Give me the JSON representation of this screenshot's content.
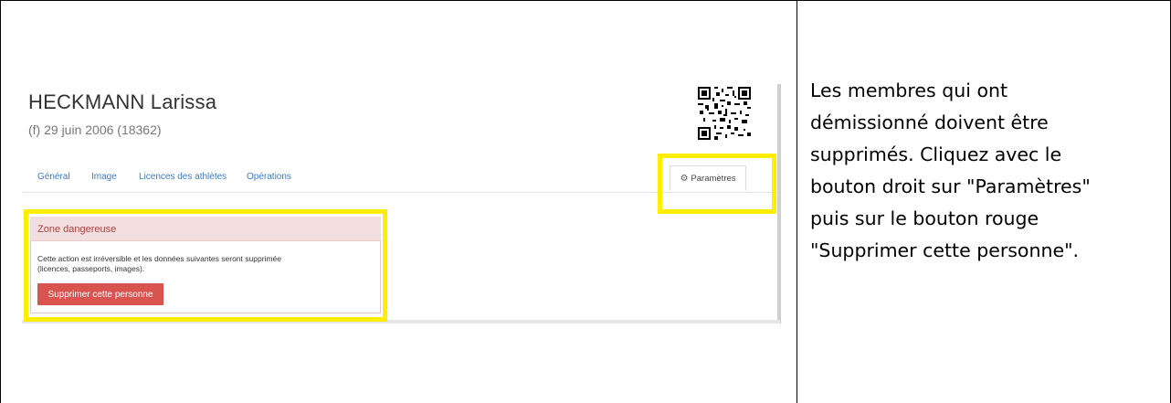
{
  "person": {
    "name": "HECKMANN Larissa",
    "subtitle": "(f) 29 juin 2006 (18362)"
  },
  "tabs": [
    {
      "label": "Général"
    },
    {
      "label": "Image"
    },
    {
      "label": "Licences des athlètes"
    },
    {
      "label": "Opérations"
    }
  ],
  "settings_tab": {
    "label": "Paramètres",
    "icon": "gear-icon"
  },
  "danger_zone": {
    "title": "Zone dangereuse",
    "text_line1": "Cette action est irréversible et les données suivantes seront supprimée",
    "text_line2": "(licences, passeports, images).",
    "button_label": "Supprimer cette personne",
    "button_color": "#d9534f",
    "header_color": "#f2dede",
    "title_color": "#a94442"
  },
  "highlight_color": "#ffee00",
  "instructions": {
    "line1": "Les membres qui ont",
    "line2": "démissionné doivent être",
    "line3": "supprimés. Cliquez avec le",
    "line4": "bouton droit sur \"Paramètres\"",
    "line5": "puis sur le bouton rouge",
    "line6": "\"Supprimer cette personne\"."
  }
}
